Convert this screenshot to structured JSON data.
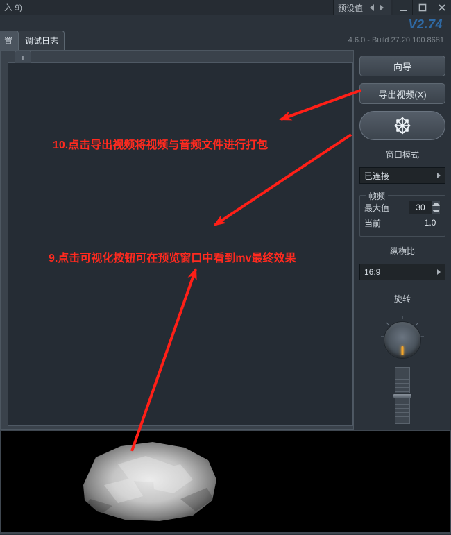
{
  "window": {
    "title_fragment": "入 9)",
    "preset_label": "预设值"
  },
  "header": {
    "version": "V2.74",
    "build": "4.6.0 - Build 27.20.100.8681",
    "tab_settings_frag": "置",
    "tab_debug_log": "调试日志"
  },
  "annotations": {
    "a10": "10.点击导出视频将视频与音频文件进行打包",
    "a9": "9.点击可视化按钮可在预览窗口中看到mv最终效果"
  },
  "side": {
    "wizard": "向导",
    "export_video": "导出视频(X)",
    "window_mode_title": "窗口模式",
    "connected": "已连接",
    "fps_group": "帧频",
    "fps_max_label": "最大值",
    "fps_max_value": "30",
    "fps_cur_label": "当前",
    "fps_cur_value": "1.0",
    "aspect_title": "纵横比",
    "aspect_value": "16:9",
    "rotate_title": "旋转"
  }
}
